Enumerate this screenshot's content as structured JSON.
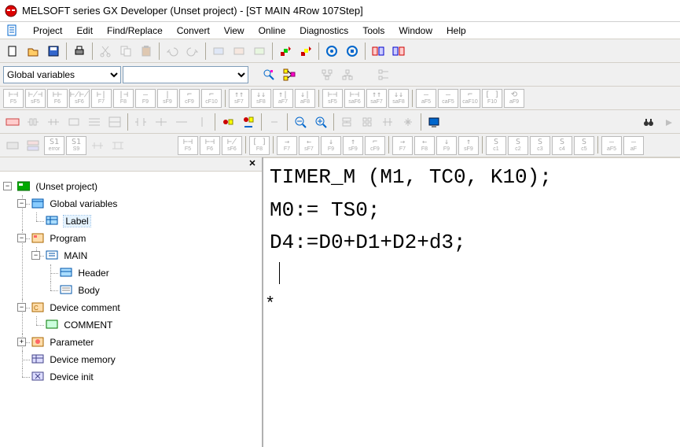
{
  "title": "MELSOFT series GX Developer (Unset project) - [ST MAIN  4Row 107Step]",
  "menu": {
    "project": "Project",
    "edit": "Edit",
    "find": "Find/Replace",
    "convert": "Convert",
    "view": "View",
    "online": "Online",
    "diagnostics": "Diagnostics",
    "tools": "Tools",
    "window": "Window",
    "help": "Help"
  },
  "combo": {
    "scope_options": [
      "Global variables"
    ],
    "scope_selected": "Global variables",
    "second_value": ""
  },
  "tree": {
    "root": "(Unset project)",
    "global_vars": "Global variables",
    "label": "Label",
    "program": "Program",
    "main": "MAIN",
    "header": "Header",
    "body": "Body",
    "dev_comment": "Device comment",
    "comment": "COMMENT",
    "parameter": "Parameter",
    "dev_memory": "Device memory",
    "dev_init": "Device init"
  },
  "code": {
    "line1": "TIMER_M (M1, TC0, K10);",
    "line2": "M0:= TS0;",
    "line3": "",
    "line4": "D4:=D0+D1+D2+d3;"
  },
  "ladder_row1_labels": [
    "F5",
    "sF5",
    "F6",
    "sF6",
    "F7",
    "F8",
    "F9",
    "sF9",
    "cF9",
    "cF10",
    "sF7",
    "sF8",
    "aF7",
    "aF8",
    "sF5",
    "saF6",
    "saF7",
    "saF8",
    "aF5",
    "caF5",
    "caF10",
    "F10",
    "aF9"
  ],
  "ladder_row3_labels": [
    "F5",
    "F6",
    "sF6",
    "F8",
    "F7",
    "sF7",
    "F9",
    "sF9",
    "cF9",
    "F7",
    "F8",
    "F9",
    "sF9",
    "c1",
    "c2",
    "c3",
    "c4",
    "c5",
    "aF5",
    "aF"
  ]
}
